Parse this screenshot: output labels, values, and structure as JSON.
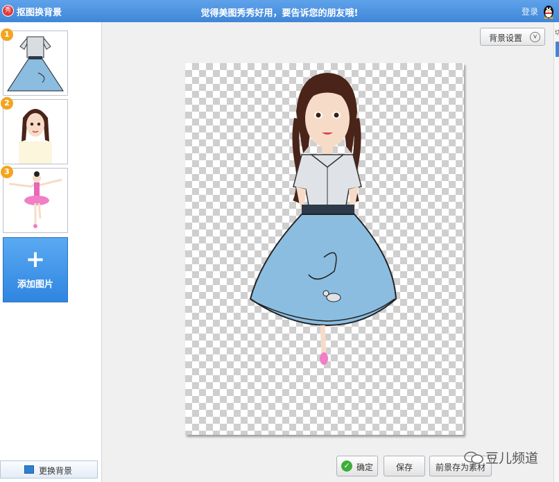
{
  "app": {
    "logo_text": "秀",
    "title": "抠图换背景",
    "banner": "觉得美图秀秀好用，要告诉您的朋友哦!",
    "login": "登录"
  },
  "sidebar": {
    "thumbnails": [
      {
        "number": "1",
        "subject": "dress-cutout"
      },
      {
        "number": "2",
        "subject": "girl-portrait"
      },
      {
        "number": "3",
        "subject": "ballerina"
      }
    ],
    "add_button": {
      "plus": "+",
      "label": "添加图片"
    },
    "change_background": "更换背景"
  },
  "toolbar": {
    "bg_settings": "背景设置",
    "bg_settings_chevron": "v"
  },
  "actions": {
    "confirm": "确定",
    "save": "保存",
    "save_foreground": "前景存为素材"
  },
  "watermark": "豆儿频道",
  "right_strip": {
    "char": "切"
  },
  "colors": {
    "titlebar": "#3f86d8",
    "accent": "#2f86e0",
    "badge": "#f3a51e",
    "skirt": "#8bbde0"
  }
}
